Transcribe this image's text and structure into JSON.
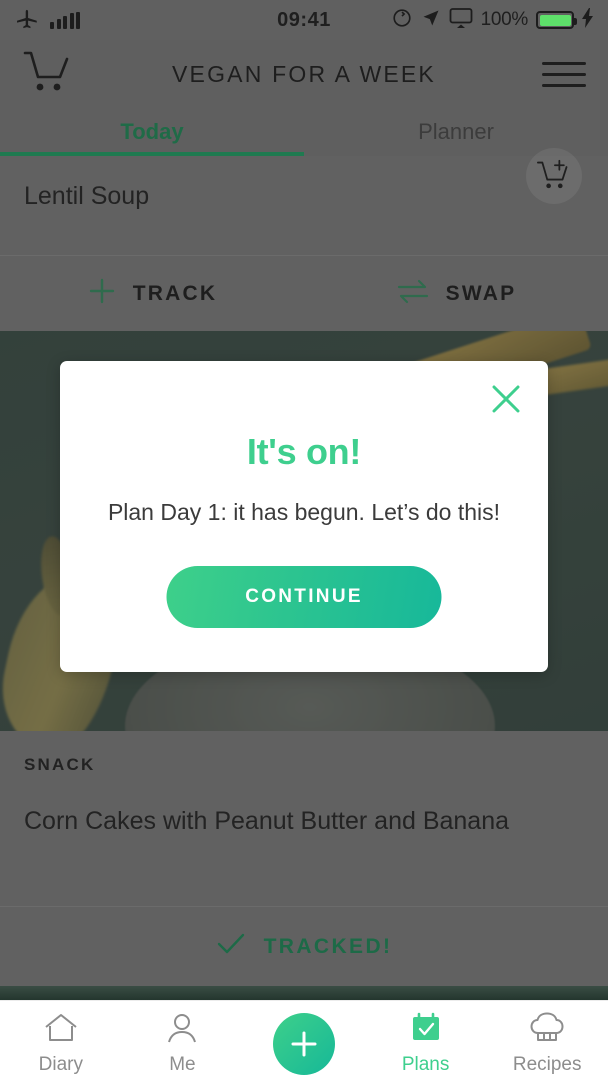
{
  "status_bar": {
    "airplane_icon": "airplane-icon",
    "signal_icon": "signal-bars-icon",
    "time": "09:41",
    "rotation_lock_icon": "rotation-lock-icon",
    "location_icon": "location-arrow-icon",
    "airplay_icon": "airplay-icon",
    "battery_percent": "100%",
    "charging_icon": "charging-bolt-icon",
    "battery_color": "#5ee06a"
  },
  "header": {
    "cart_icon": "shopping-cart-icon",
    "title": "VEGAN FOR A WEEK",
    "menu_icon": "hamburger-menu-icon"
  },
  "tabs": [
    {
      "label": "Today",
      "active": true
    },
    {
      "label": "Planner",
      "active": false
    }
  ],
  "meals": [
    {
      "kicker": "",
      "title": "Lentil Soup",
      "add_icon": "cart-plus-icon",
      "actions": [
        {
          "label": "TRACK",
          "icon": "plus-icon"
        },
        {
          "label": "SWAP",
          "icon": "swap-arrows-icon"
        }
      ]
    },
    {
      "kicker": "SNACK",
      "title": "Corn Cakes with Peanut Butter and Banana",
      "status": {
        "label": "TRACKED!",
        "icon": "check-icon"
      }
    }
  ],
  "modal": {
    "close_icon": "close-x-icon",
    "title": "It's on!",
    "body": "Plan Day 1: it has begun. Let’s do this!",
    "button_label": "CONTINUE",
    "accent_color": "#3ecf8e",
    "button_gradient_from": "#3ed08a",
    "button_gradient_to": "#17b89a"
  },
  "bottom_nav": {
    "items": [
      {
        "label": "Diary",
        "icon": "home-icon",
        "active": false
      },
      {
        "label": "Me",
        "icon": "person-icon",
        "active": false
      },
      {
        "label": "Plans",
        "icon": "calendar-check-icon",
        "active": true
      },
      {
        "label": "Recipes",
        "icon": "chef-hat-icon",
        "active": false
      }
    ],
    "fab": {
      "icon": "plus-icon",
      "color": "#2cc48f"
    },
    "active_color": "#3ecf8e"
  }
}
